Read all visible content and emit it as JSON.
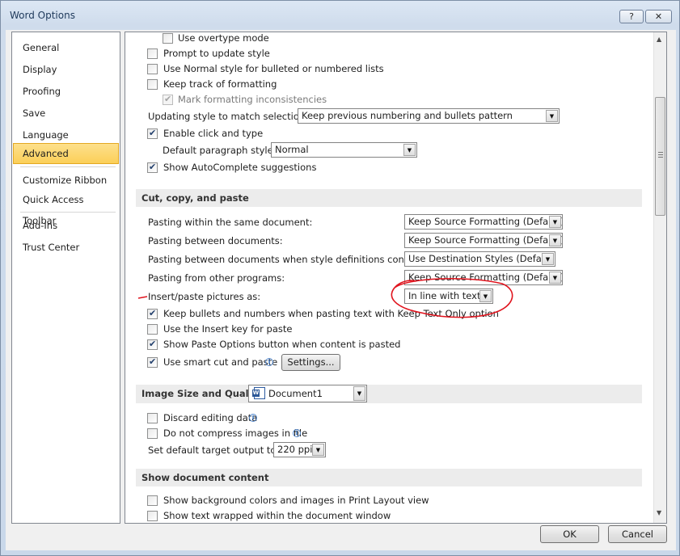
{
  "window": {
    "title": "Word Options",
    "help_label": "?",
    "close_label": "✕"
  },
  "nav": {
    "items": [
      {
        "label": "General"
      },
      {
        "label": "Display"
      },
      {
        "label": "Proofing"
      },
      {
        "label": "Save"
      },
      {
        "label": "Language"
      },
      {
        "label": "Advanced",
        "selected": true
      },
      {
        "label": "Customize Ribbon"
      },
      {
        "label": "Quick Access Toolbar"
      },
      {
        "label": "Add-Ins"
      },
      {
        "label": "Trust Center"
      }
    ]
  },
  "editing": {
    "overtype": {
      "label": "Use overtype mode",
      "checked": false
    },
    "prompt_update_style": {
      "label": "Prompt to update style",
      "checked": false
    },
    "normal_style_lists": {
      "label": "Use Normal style for bulleted or numbered lists",
      "checked": false
    },
    "track_formatting": {
      "label": "Keep track of formatting",
      "checked": false
    },
    "mark_inconsistencies": {
      "label": "Mark formatting inconsistencies",
      "checked": true,
      "disabled": true
    },
    "updating_style": {
      "label": "Updating style to match selection:",
      "value": "Keep previous numbering and bullets pattern"
    },
    "click_and_type": {
      "label": "Enable click and type",
      "checked": true
    },
    "default_paragraph_style": {
      "label": "Default paragraph style:",
      "value": "Normal"
    },
    "autocomplete": {
      "label": "Show AutoComplete suggestions",
      "checked": true
    }
  },
  "cut_copy_paste": {
    "header": "Cut, copy, and paste",
    "within_document": {
      "label": "Pasting within the same document:",
      "value": "Keep Source Formatting (Default)"
    },
    "between_documents": {
      "label": "Pasting between documents:",
      "value": "Keep Source Formatting (Default)"
    },
    "between_conflict": {
      "label": "Pasting between documents when style definitions conflict:",
      "value": "Use Destination Styles (Default)"
    },
    "other_programs": {
      "label": "Pasting from other programs:",
      "value": "Keep Source Formatting (Default)"
    },
    "pictures_as": {
      "label": "Insert/paste pictures as:",
      "value": "In line with text"
    },
    "keep_bullets": {
      "label": "Keep bullets and numbers when pasting text with Keep Text Only option",
      "checked": true
    },
    "insert_key": {
      "label": "Use the Insert key for paste",
      "checked": false
    },
    "paste_options_button": {
      "label": "Show Paste Options button when content is pasted",
      "checked": true
    },
    "smart_cut": {
      "label": "Use smart cut and paste",
      "checked": true
    },
    "settings_button": "Settings..."
  },
  "image_size": {
    "header": "Image Size and Quality",
    "document": "Document1",
    "discard_editing": {
      "label": "Discard editing data",
      "checked": false
    },
    "no_compress": {
      "label": "Do not compress images in file",
      "checked": false
    },
    "target_output": {
      "label": "Set default target output to:",
      "value": "220 ppi"
    }
  },
  "show_content": {
    "header": "Show document content",
    "background_colors": {
      "label": "Show background colors and images in Print Layout view",
      "checked": false
    },
    "text_wrapped": {
      "label": "Show text wrapped within the document window",
      "checked": false
    }
  },
  "footer": {
    "ok": "OK",
    "cancel": "Cancel"
  },
  "icons": {
    "info": "i",
    "dropdown": "▼",
    "scroll_up": "▲",
    "scroll_down": "▼"
  },
  "colors": {
    "selected_nav": "#fbcf58",
    "annotation": "#e0141e"
  }
}
